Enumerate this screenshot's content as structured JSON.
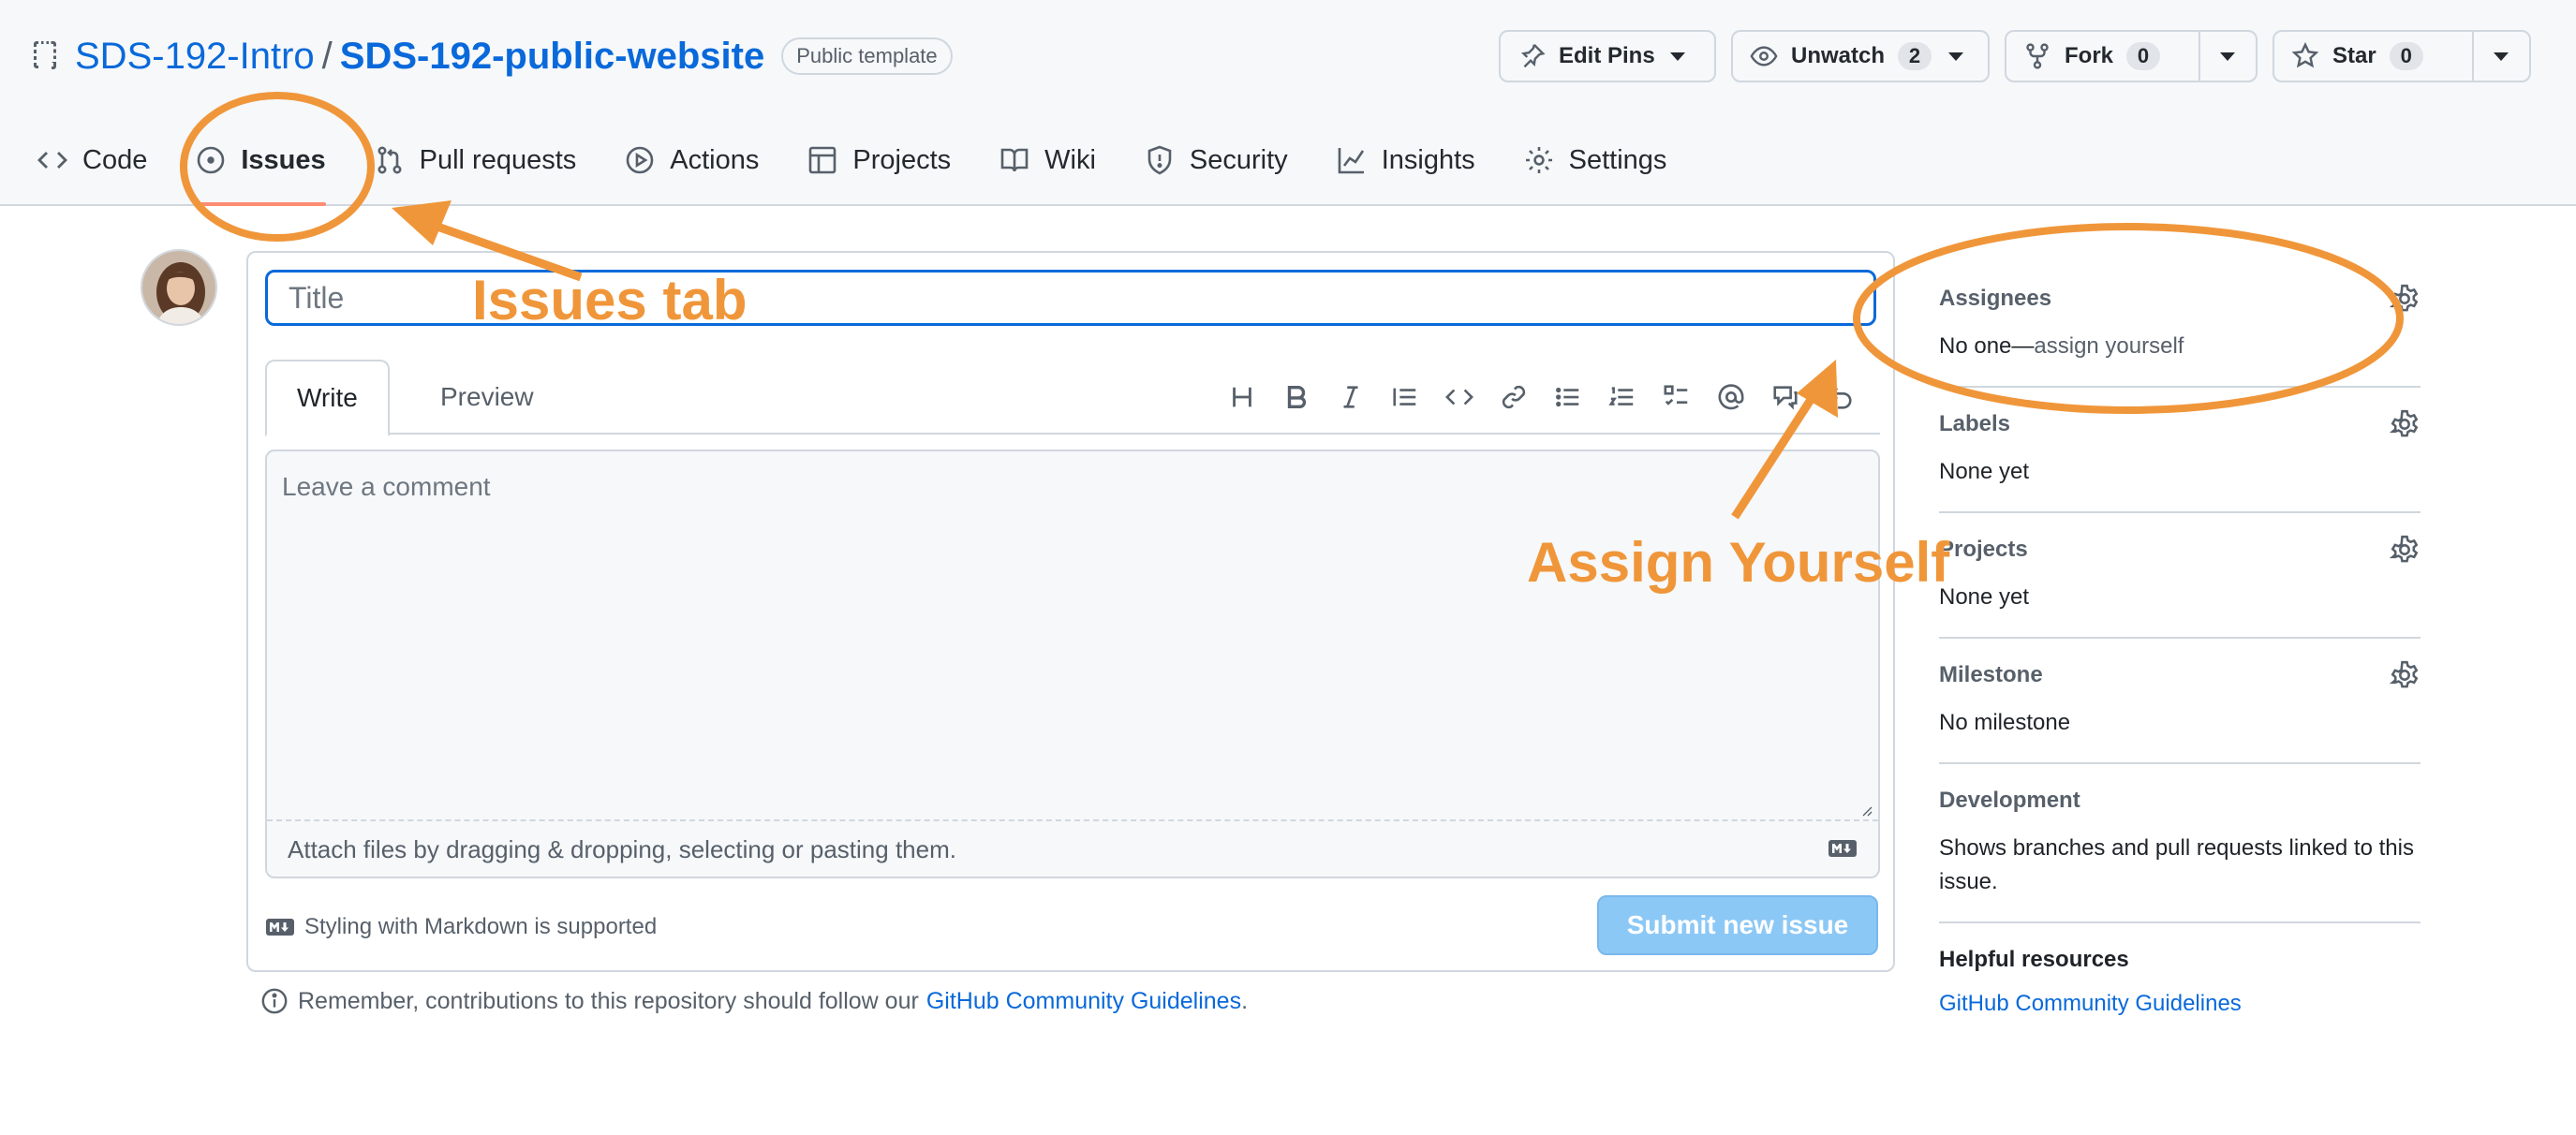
{
  "repo": {
    "owner": "SDS-192-Intro",
    "separator": "/",
    "name": "SDS-192-public-website",
    "badge": "Public template"
  },
  "header_buttons": {
    "edit_pins": "Edit Pins",
    "unwatch": "Unwatch",
    "unwatch_count": "2",
    "fork": "Fork",
    "fork_count": "0",
    "star": "Star",
    "star_count": "0"
  },
  "nav": {
    "tabs": [
      {
        "label": "Code",
        "icon": "code-icon"
      },
      {
        "label": "Issues",
        "icon": "issue-opened-icon",
        "active": true
      },
      {
        "label": "Pull requests",
        "icon": "git-pull-request-icon"
      },
      {
        "label": "Actions",
        "icon": "play-icon"
      },
      {
        "label": "Projects",
        "icon": "table-icon"
      },
      {
        "label": "Wiki",
        "icon": "book-icon"
      },
      {
        "label": "Security",
        "icon": "shield-icon"
      },
      {
        "label": "Insights",
        "icon": "graph-icon"
      },
      {
        "label": "Settings",
        "icon": "gear-icon"
      }
    ]
  },
  "form": {
    "title_placeholder": "Title",
    "write_tab": "Write",
    "preview_tab": "Preview",
    "comment_placeholder": "Leave a comment",
    "attach_text": "Attach files by dragging & dropping, selecting or pasting them.",
    "markdown_note": "Styling with Markdown is supported",
    "submit_label": "Submit new issue",
    "toolbar_icons": [
      "heading-icon",
      "bold-icon",
      "italic-icon",
      "quote-icon",
      "code-icon",
      "link-icon",
      "unordered-list-icon",
      "ordered-list-icon",
      "task-list-icon",
      "mention-icon",
      "reference-icon",
      "undo-icon"
    ]
  },
  "footer_note": {
    "text": "Remember, contributions to this repository should follow our",
    "link": "GitHub Community Guidelines",
    "period": "."
  },
  "sidebar": {
    "assignees": {
      "label": "Assignees",
      "value_prefix": "No one—",
      "value_link": "assign yourself"
    },
    "labels": {
      "label": "Labels",
      "value": "None yet"
    },
    "projects": {
      "label": "Projects",
      "value": "None yet"
    },
    "milestone": {
      "label": "Milestone",
      "value": "No milestone"
    },
    "development": {
      "label": "Development",
      "value": "Shows branches and pull requests linked to this issue."
    },
    "helpful": {
      "label": "Helpful resources",
      "link": "GitHub Community Guidelines"
    }
  },
  "annotations": {
    "issues_tab": "Issues tab",
    "assign_yourself": "Assign Yourself",
    "color": "#f0963a"
  },
  "colors": {
    "link": "#0969da",
    "active_tab_underline": "#fd8c73",
    "submit_button": "#8cc8f5",
    "focus_border": "#0969da"
  }
}
